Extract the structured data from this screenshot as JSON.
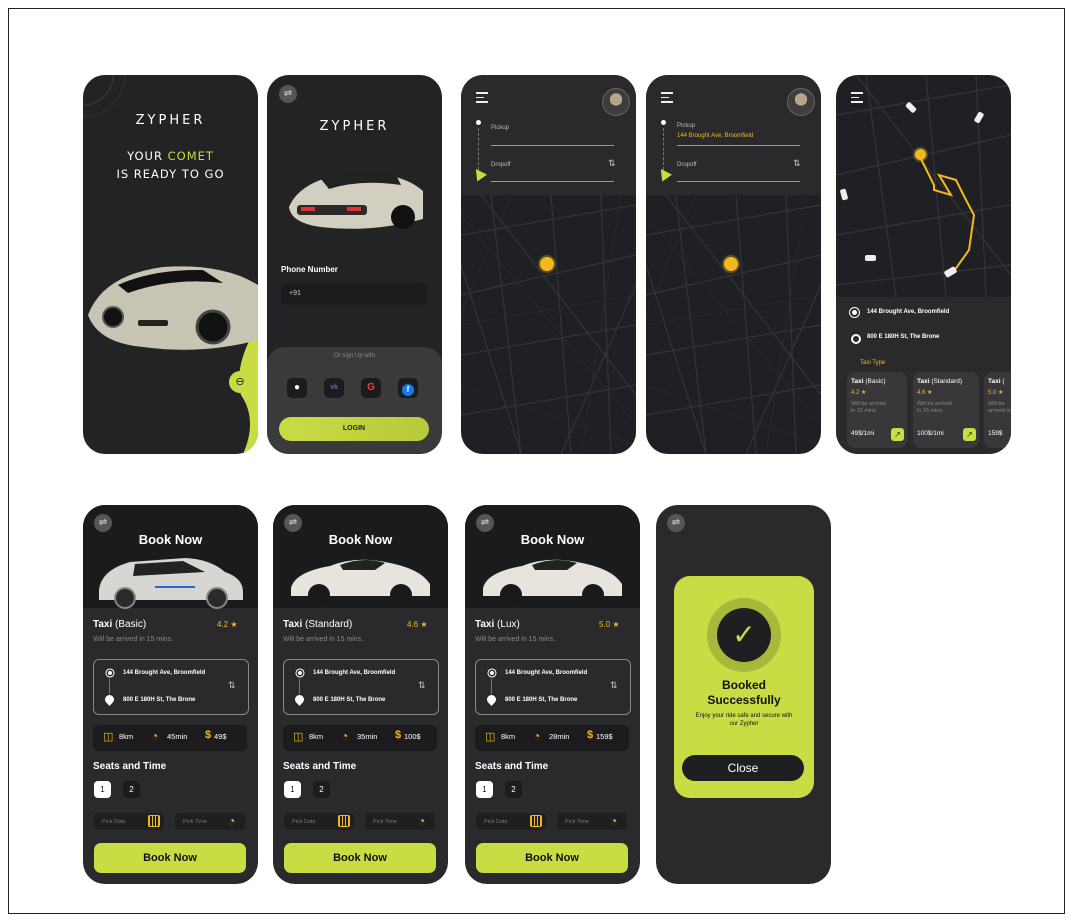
{
  "brand": "ZYPHER",
  "screen1": {
    "tagline_prefix": "YOUR ",
    "tagline_highlight": "COMET",
    "tagline_line2": "IS READY TO GO"
  },
  "login": {
    "phone_label": "Phone Number",
    "phone_value": "+91",
    "signup_with": "Or sign Up with",
    "social": [
      "apple-icon",
      "vk-icon",
      "google-icon",
      "facebook-icon"
    ],
    "login_btn": "LOGIN"
  },
  "map": {
    "pickup_label": "Pickup",
    "dropoff_label": "Dropoff",
    "pickup_value": "144 Brought Ave, Broomfield"
  },
  "route": {
    "from": "144 Brought Ave, Broomfield",
    "to": "800 E 180H St, The Brone",
    "taxi_type_label": "Taxi Type",
    "taxis": [
      {
        "name": "Taxi",
        "variant": "(Basic)",
        "rating": "4.2 ★",
        "eta": "Will be arrived in 15 mins",
        "price": "49$/1mi"
      },
      {
        "name": "Taxi",
        "variant": "(Standard)",
        "rating": "4.6 ★",
        "eta": "Will be arrived in 15 mins",
        "price": "100$/1mi"
      },
      {
        "name": "Taxi",
        "variant": "(",
        "rating": "5.0 ★",
        "eta": "Will be arrived in 15 mins",
        "price": "159$"
      }
    ]
  },
  "booking": [
    {
      "title": "Book Now",
      "name": "Taxi",
      "variant": " (Basic)",
      "rating": "4.2 ★",
      "eta": "Will be arrived in 15 mins.",
      "distance": "8km",
      "time": "45min",
      "price": "49$"
    },
    {
      "title": "Book Now",
      "name": "Taxi",
      "variant": " (Standard)",
      "rating": "4.6 ★",
      "eta": "Will be arrived in 15 mins.",
      "distance": "8km",
      "time": "35min",
      "price": "100$"
    },
    {
      "title": "Book Now",
      "name": "Taxi",
      "variant": " (Lux)",
      "rating": "5.0 ★",
      "eta": "Will be arrived in 15 mins.",
      "distance": "8km",
      "time": "28min",
      "price": "159$"
    }
  ],
  "booking_common": {
    "from": "144 Brought Ave, Broomfield",
    "to": "800 E 180H St, The Brone",
    "seats_label": "Seats and Time",
    "seat1": "1",
    "seat2": "2",
    "pick_date": "Pick Date",
    "pick_time": "Pick Time",
    "book_btn": "Book Now"
  },
  "success": {
    "title_line1": "Booked",
    "title_line2": "Successfully",
    "message": "Enjoy your ride safe and secure with our Zypher",
    "close_btn": "Close"
  },
  "colors": {
    "accent": "#c9dc44",
    "gold": "#f2b81f",
    "phone_bg": "#2a2a2c"
  }
}
